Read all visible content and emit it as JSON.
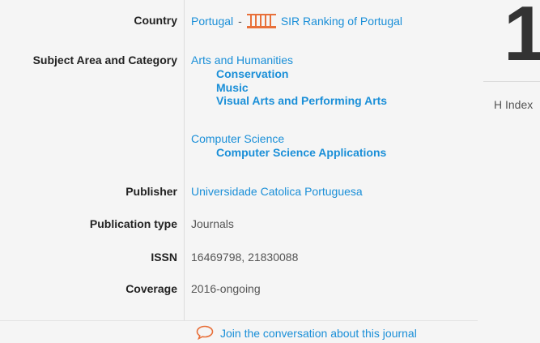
{
  "country": {
    "label": "Country",
    "value": "Portugal",
    "separator": "-",
    "sir_link": "SIR Ranking of Portugal",
    "icon": "sir-ranking-icon"
  },
  "subject": {
    "label": "Subject Area and Category",
    "areas": [
      {
        "name": "Arts and Humanities",
        "categories": [
          "Conservation",
          "Music",
          "Visual Arts and Performing Arts"
        ]
      },
      {
        "name": "Computer Science",
        "categories": [
          "Computer Science Applications"
        ]
      }
    ]
  },
  "publisher": {
    "label": "Publisher",
    "value": "Universidade Catolica Portuguesa"
  },
  "publication_type": {
    "label": "Publication type",
    "value": "Journals"
  },
  "issn": {
    "label": "ISSN",
    "value": "16469798, 21830088"
  },
  "coverage": {
    "label": "Coverage",
    "value": "2016-ongoing"
  },
  "conversation": {
    "text": "Join the conversation about this journal",
    "icon": "speech-bubble-icon"
  },
  "h_index": {
    "value": "1",
    "label": "H Index"
  },
  "colors": {
    "link": "#1a8fd8",
    "accent": "#e8703a",
    "label": "#222222"
  }
}
